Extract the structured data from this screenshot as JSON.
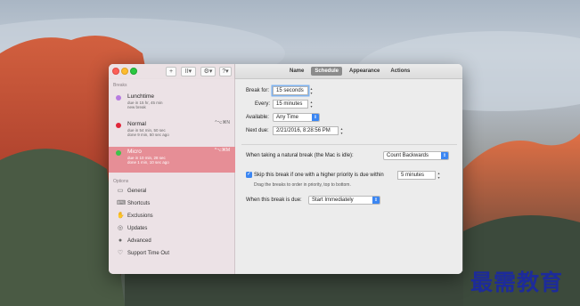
{
  "window": {
    "toolbar": {
      "add_label": "+",
      "pause_label": "II▾",
      "gear_label": "⚙▾",
      "help_label": "?▾"
    },
    "tabs": [
      {
        "label": "Name",
        "active": false
      },
      {
        "label": "Schedule",
        "active": true
      },
      {
        "label": "Appearance",
        "active": false
      },
      {
        "label": "Actions",
        "active": false
      }
    ]
  },
  "sidebar": {
    "breaks_label": "Breaks",
    "options_label": "Options",
    "breaks": [
      {
        "name": "Lunchtime",
        "line1": "due in 15 hr, 45 min",
        "line2": "new break",
        "key": "",
        "color": "#b77ce0"
      },
      {
        "name": "Normal",
        "line1": "due in 54 min, 50 sec",
        "line2": "done 9 min, 50 sec ago",
        "key": "^⌥⌘N",
        "color": "#e0263a"
      },
      {
        "name": "Micro",
        "line1": "due in 10 min, 28 sec",
        "line2": "done 1 min, 10 sec ago",
        "key": "^⌥⌘M",
        "color": "#3ec24a"
      }
    ],
    "options": [
      {
        "label": "General",
        "icon": "general-icon"
      },
      {
        "label": "Shortcuts",
        "icon": "shortcuts-icon"
      },
      {
        "label": "Exclusions",
        "icon": "exclusions-icon"
      },
      {
        "label": "Updates",
        "icon": "updates-icon"
      },
      {
        "label": "Advanced",
        "icon": "advanced-icon"
      },
      {
        "label": "Support Time Out",
        "icon": "support-icon"
      }
    ]
  },
  "schedule": {
    "break_for_label": "Break for:",
    "break_for_value": "15 seconds",
    "every_label": "Every:",
    "every_value": "15 minutes",
    "available_label": "Available:",
    "available_value": "Any Time",
    "next_due_label": "Next due:",
    "next_due_value": "2/21/2016, 8:28:56 PM",
    "natural_break_label": "When taking a natural break (the Mac is idle):",
    "natural_break_value": "Count Backwards",
    "skip_label": "Skip this break if one with a higher priority is due within",
    "skip_value": "5 minutes",
    "skip_checked": true,
    "drag_hint": "Drag the breaks to order in priority, top to bottom.",
    "break_due_label": "When this break is due:",
    "break_due_value": "Start Immediately"
  },
  "watermark": "最需教育"
}
